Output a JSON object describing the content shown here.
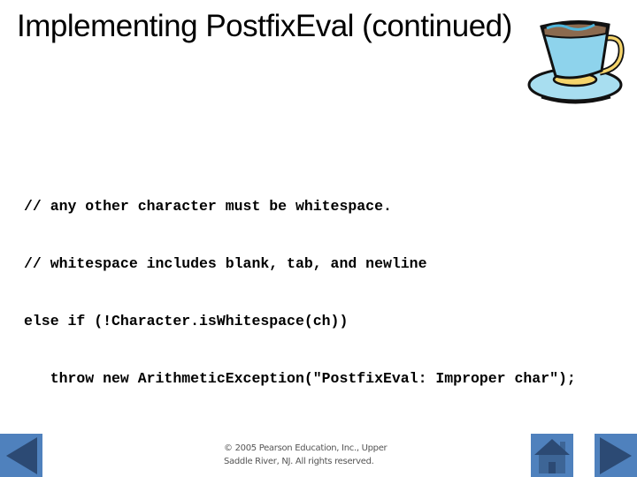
{
  "slide": {
    "title": "Implementing PostfixEval (continued)",
    "clipart": "coffee-cup-icon",
    "code_lines": [
      "// any other character must be whitespace.",
      "// whitespace includes blank, tab, and newline",
      "else if (!Character.isWhitespace(ch))",
      "   throw new ArithmeticException(\"PostfixEval: Improper char\");"
    ],
    "footer": {
      "line1": "© 2005 Pearson Education, Inc., Upper",
      "line2": "Saddle River, NJ.  All rights reserved."
    }
  },
  "navigation": {
    "prev": {
      "icon": "left-triangle-icon",
      "label": "Previous slide"
    },
    "home": {
      "icon": "home-icon",
      "label": "Home"
    },
    "next": {
      "icon": "right-triangle-icon",
      "label": "Next slide"
    }
  },
  "colors": {
    "nav_button": "#4f81bd",
    "nav_glyph": "#2c4a74",
    "cup_body": "#8ed3ec",
    "cup_coffee": "#8b6a4f",
    "cup_accent": "#f5d46b"
  }
}
